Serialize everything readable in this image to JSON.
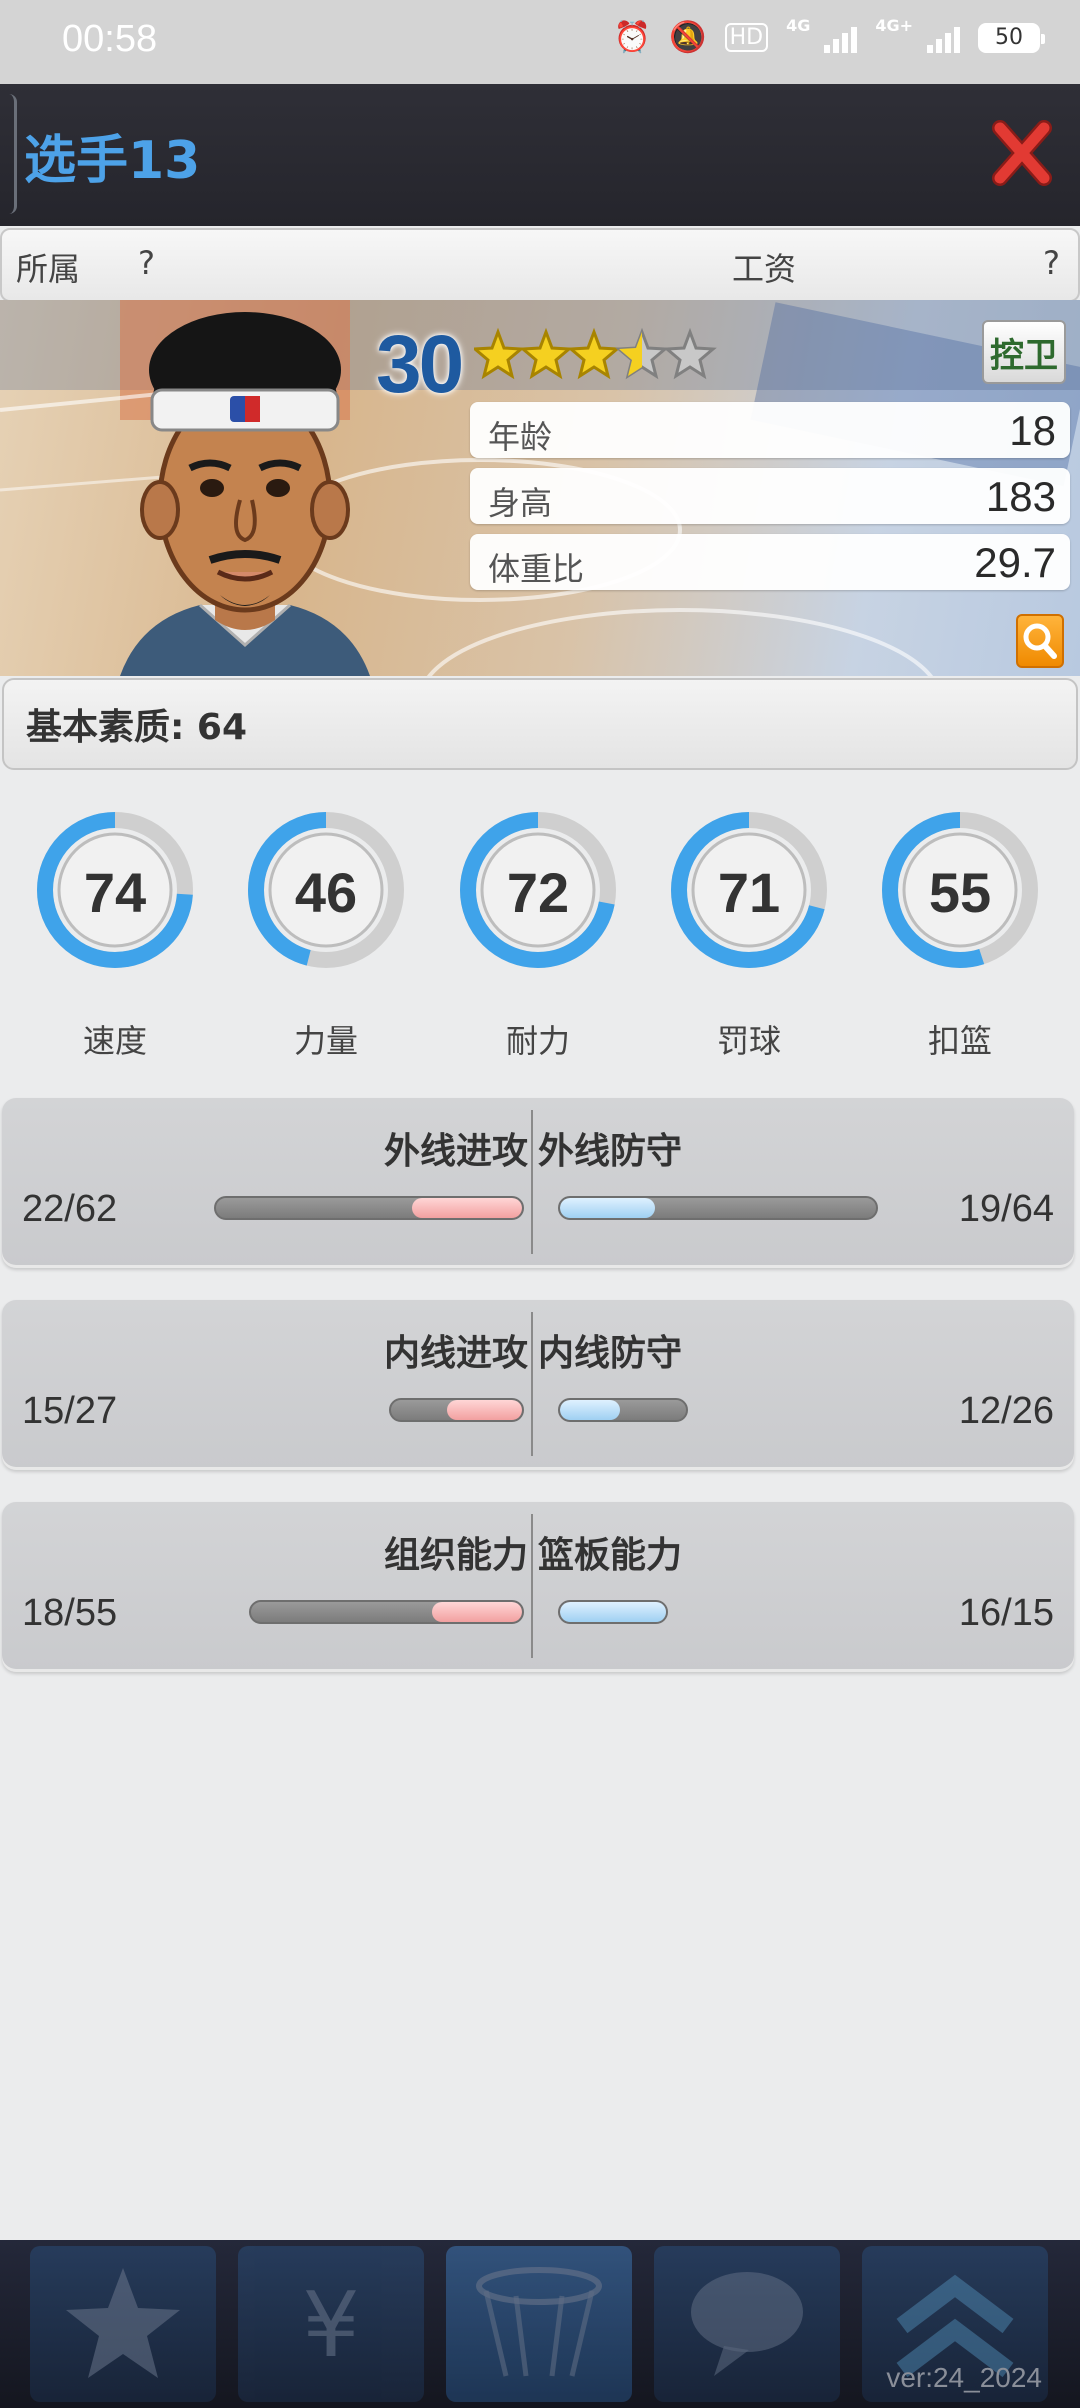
{
  "status_bar": {
    "time": "00:58",
    "network_1": "4G",
    "network_2": "4G+",
    "battery": "50"
  },
  "header": {
    "title": "选手13"
  },
  "info_bar": {
    "team_label": "所属",
    "team_value": "?",
    "salary_label": "工资",
    "salary_value": "?"
  },
  "player": {
    "rating": "30",
    "stars": 3.5,
    "position": "控卫",
    "attributes": [
      {
        "label": "年龄",
        "value": "18"
      },
      {
        "label": "身高",
        "value": "183"
      },
      {
        "label": "体重比",
        "value": "29.7"
      }
    ]
  },
  "basic_quality": "基本素质: 64",
  "abilities": [
    {
      "label": "速度",
      "value": "74",
      "fill": 0.74
    },
    {
      "label": "力量",
      "value": "46",
      "fill": 0.46
    },
    {
      "label": "耐力",
      "value": "72",
      "fill": 0.72
    },
    {
      "label": "罚球",
      "value": "71",
      "fill": 0.71
    },
    {
      "label": "扣篮",
      "value": "55",
      "fill": 0.55
    }
  ],
  "skills": [
    {
      "left": {
        "title": "外线进攻",
        "value": "22/62",
        "current": 22,
        "max": 62
      },
      "right": {
        "title": "外线防守",
        "value": "19/64",
        "current": 19,
        "max": 64
      }
    },
    {
      "left": {
        "title": "内线进攻",
        "value": "15/27",
        "current": 15,
        "max": 27
      },
      "right": {
        "title": "内线防守",
        "value": "12/26",
        "current": 12,
        "max": 26
      }
    },
    {
      "left": {
        "title": "组织能力",
        "value": "18/55",
        "current": 18,
        "max": 55
      },
      "right": {
        "title": "篮板能力",
        "value": "16/15",
        "current": 16,
        "max": 15
      }
    }
  ],
  "colors": {
    "accent": "#4da2e8",
    "ring": "#3fa3ea",
    "close": "#e23a33",
    "star": "#f5d020"
  },
  "footer": {
    "version": "ver:24_2024"
  }
}
